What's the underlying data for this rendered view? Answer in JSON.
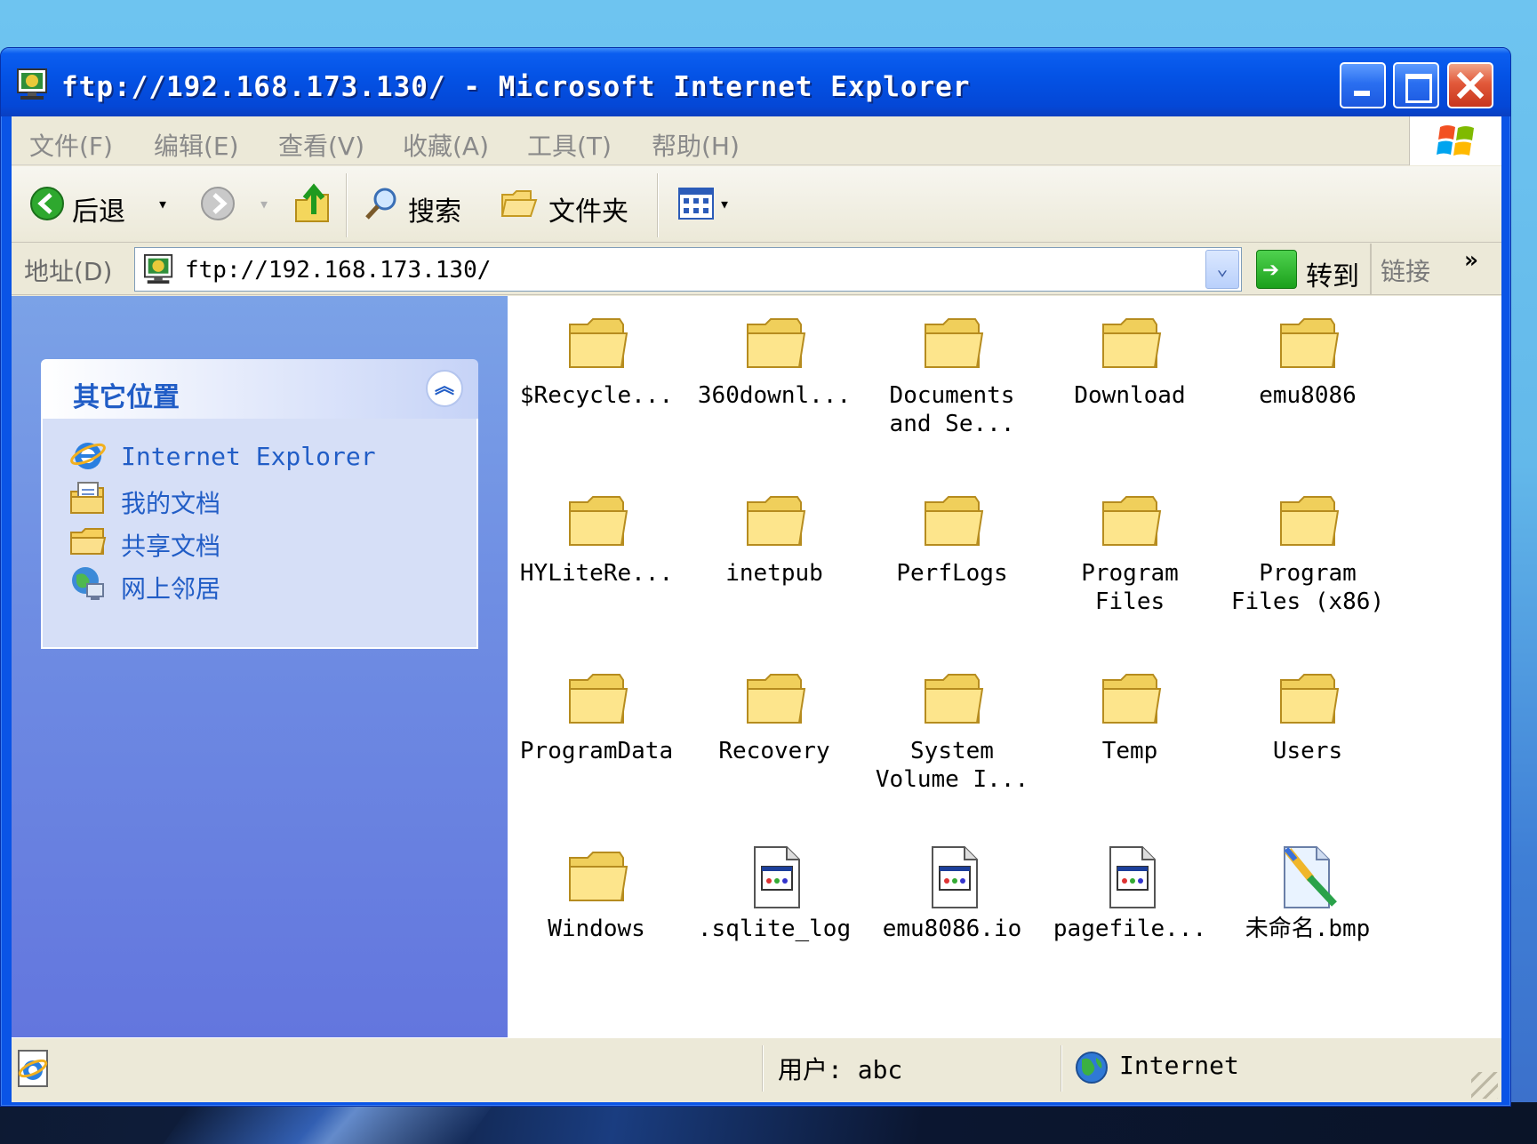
{
  "window": {
    "title": "ftp://192.168.173.130/ - Microsoft Internet Explorer"
  },
  "menu": {
    "items": [
      "文件(F)",
      "编辑(E)",
      "查看(V)",
      "收藏(A)",
      "工具(T)",
      "帮助(H)"
    ]
  },
  "toolbar": {
    "back_label": "后退",
    "search_label": "搜索",
    "folders_label": "文件夹"
  },
  "address": {
    "label": "地址(D)",
    "value": "ftp://192.168.173.130/",
    "go_label": "转到",
    "links_label": "链接",
    "links_chevron": "»"
  },
  "sidebar": {
    "panel_title": "其它位置",
    "collapse_glyph": "︽",
    "places": [
      {
        "label": "Internet Explorer",
        "icon": "ie-icon"
      },
      {
        "label": "我的文档",
        "icon": "documents-icon"
      },
      {
        "label": "共享文档",
        "icon": "shared-folder-icon"
      },
      {
        "label": "网上邻居",
        "icon": "network-icon"
      }
    ]
  },
  "files": [
    {
      "label": "$Recycle...",
      "type": "folder"
    },
    {
      "label": "360downl...",
      "type": "folder"
    },
    {
      "label": "Documents\nand Se...",
      "type": "folder"
    },
    {
      "label": "Download",
      "type": "folder"
    },
    {
      "label": "emu8086",
      "type": "folder"
    },
    {
      "label": "HYLiteRe...",
      "type": "folder"
    },
    {
      "label": "inetpub",
      "type": "folder"
    },
    {
      "label": "PerfLogs",
      "type": "folder"
    },
    {
      "label": "Program\nFiles",
      "type": "folder"
    },
    {
      "label": "Program\nFiles (x86)",
      "type": "folder"
    },
    {
      "label": "ProgramData",
      "type": "folder"
    },
    {
      "label": "Recovery",
      "type": "folder"
    },
    {
      "label": "System\nVolume I...",
      "type": "folder"
    },
    {
      "label": "Temp",
      "type": "folder"
    },
    {
      "label": "Users",
      "type": "folder"
    },
    {
      "label": "Windows",
      "type": "folder"
    },
    {
      "label": ".sqlite_log",
      "type": "file"
    },
    {
      "label": "emu8086.io",
      "type": "file"
    },
    {
      "label": "pagefile...",
      "type": "file"
    },
    {
      "label": "未命名.bmp",
      "type": "bitmap"
    }
  ],
  "status": {
    "user": "用户: abc",
    "zone": "Internet"
  },
  "colors": {
    "titlebar": "#0453e6",
    "sidebar": "#6f8ee3",
    "link": "#215dc6",
    "chrome": "#ece9d8"
  }
}
